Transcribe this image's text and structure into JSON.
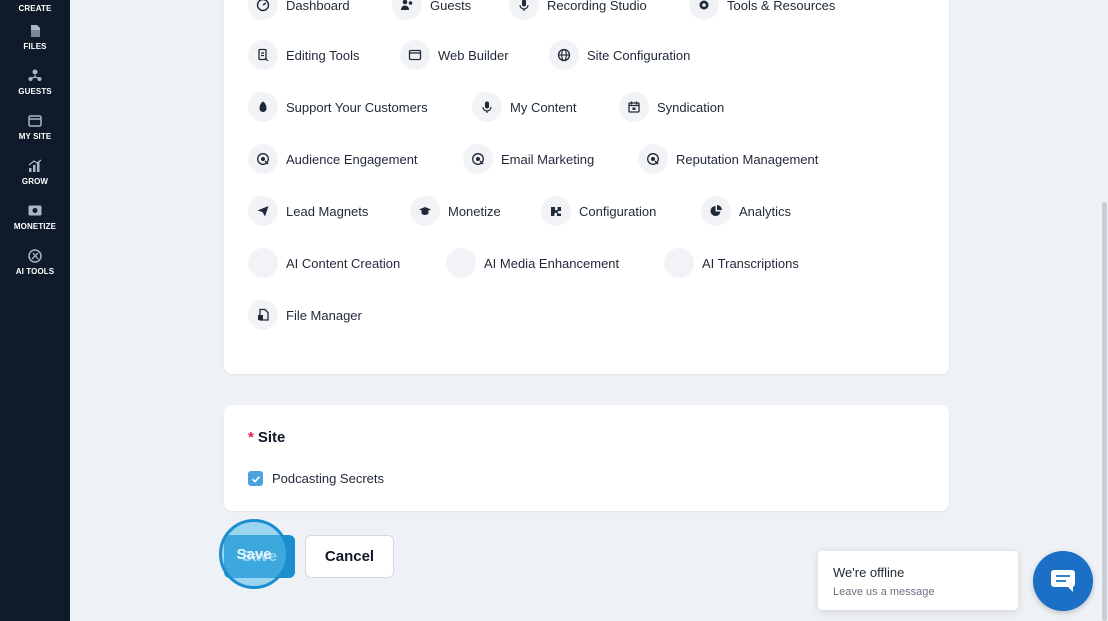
{
  "sidebar": {
    "items": [
      {
        "label": "CREATE",
        "icon": "create-icon"
      },
      {
        "label": "FILES",
        "icon": "files-icon"
      },
      {
        "label": "GUESTS",
        "icon": "guests-icon"
      },
      {
        "label": "MY SITE",
        "icon": "my-site-icon"
      },
      {
        "label": "GROW",
        "icon": "grow-icon"
      },
      {
        "label": "MONETIZE",
        "icon": "monetize-icon"
      },
      {
        "label": "AI TOOLS",
        "icon": "ai-tools-icon"
      }
    ]
  },
  "permissions": {
    "items": [
      {
        "label": "Dashboard",
        "icon": "dashboard-icon"
      },
      {
        "label": "Guests",
        "icon": "guests-icon"
      },
      {
        "label": "Recording Studio",
        "icon": "microphone-icon"
      },
      {
        "label": "Tools & Resources",
        "icon": "gear-icon"
      },
      {
        "label": "Editing Tools",
        "icon": "editing-icon"
      },
      {
        "label": "Web Builder",
        "icon": "browser-icon"
      },
      {
        "label": "Site Configuration",
        "icon": "globe-icon"
      },
      {
        "label": "Support Your Customers",
        "icon": "support-icon"
      },
      {
        "label": "My Content",
        "icon": "microphone-icon"
      },
      {
        "label": "Syndication",
        "icon": "calendar-icon"
      },
      {
        "label": "Audience Engagement",
        "icon": "engagement-icon"
      },
      {
        "label": "Email Marketing",
        "icon": "engagement-icon"
      },
      {
        "label": "Reputation Management",
        "icon": "engagement-icon"
      },
      {
        "label": "Lead Magnets",
        "icon": "paper-plane-icon"
      },
      {
        "label": "Monetize",
        "icon": "graduation-cap-icon"
      },
      {
        "label": "Configuration",
        "icon": "puzzle-icon"
      },
      {
        "label": "Analytics",
        "icon": "pie-chart-icon"
      },
      {
        "label": "AI Content Creation",
        "icon": "blank-icon"
      },
      {
        "label": "AI Media Enhancement",
        "icon": "blank-icon"
      },
      {
        "label": "AI Transcriptions",
        "icon": "blank-icon"
      },
      {
        "label": "File Manager",
        "icon": "file-icon"
      }
    ]
  },
  "site": {
    "required_mark": "*",
    "title": "Site",
    "option_label": "Podcasting Secrets",
    "option_checked": true
  },
  "actions": {
    "save_label": "Save",
    "cancel_label": "Cancel"
  },
  "chat": {
    "status": "We're offline",
    "subtext": "Leave us a message"
  },
  "colors": {
    "sidebar_bg": "#0f1a2b",
    "accent": "#1b8ecf",
    "chat_bubble": "#1b6fc4",
    "required": "#e11d48",
    "checkbox": "#4aa3df"
  }
}
